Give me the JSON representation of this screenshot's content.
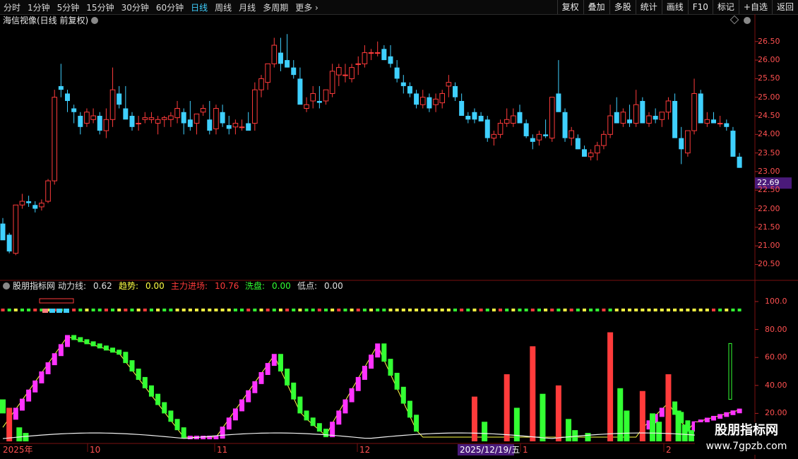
{
  "toolbar": {
    "timeframes": [
      "分时",
      "1分钟",
      "5分钟",
      "15分钟",
      "30分钟",
      "60分钟",
      "日线",
      "周线",
      "月线",
      "多周期",
      "更多"
    ],
    "active_index": 6,
    "right_buttons": [
      "复权",
      "叠加",
      "多股",
      "统计",
      "画线",
      "F10",
      "标记",
      "+自选",
      "返回"
    ]
  },
  "main": {
    "title": "海信视像(日线 前复权)",
    "current_price": "22.69",
    "y_ticks": [
      "26.50",
      "26.00",
      "25.50",
      "25.00",
      "24.50",
      "24.00",
      "23.50",
      "23.00",
      "22.50",
      "22.00",
      "21.50",
      "21.00",
      "20.50"
    ]
  },
  "indicator": {
    "name": "股朋指标网",
    "items": [
      {
        "label": "动力线:",
        "value": "0.62",
        "color": "#e0e0e0"
      },
      {
        "label": "趋势:",
        "value": "0.00",
        "color": "#ffff44"
      },
      {
        "label": "主力进场:",
        "value": "10.76",
        "color": "#ff3b3b"
      },
      {
        "label": "洗盘:",
        "value": "0.00",
        "color": "#33ff33"
      },
      {
        "label": "低点:",
        "value": "0.00",
        "color": "#e0e0e0"
      }
    ],
    "y_ticks": [
      "100.0",
      "80.00",
      "60.00",
      "40.00",
      "20.00"
    ]
  },
  "date_axis": {
    "year": "2025年",
    "months": [
      "10",
      "11",
      "12",
      "1",
      "2"
    ],
    "cursor_date": "2025/12/19/五"
  },
  "watermark": {
    "site": "股朋指标网",
    "url": "www.7gpzb.com"
  },
  "colors": {
    "up": "#ff3b3b",
    "down": "#3fd0ff",
    "magenta": "#ff33ff",
    "green": "#33ff33",
    "yellow": "#ffff44"
  },
  "chart_data": {
    "type": "candlestick",
    "ylim": [
      20.3,
      26.8
    ],
    "ohlc": [
      [
        21.6,
        21.75,
        21.2,
        21.15
      ],
      [
        21.3,
        21.35,
        20.8,
        20.85
      ],
      [
        20.8,
        22.1,
        20.75,
        22.1
      ],
      [
        22.1,
        22.4,
        22.0,
        22.2
      ],
      [
        22.2,
        22.35,
        22.05,
        22.15
      ],
      [
        22.1,
        22.2,
        21.9,
        22.0
      ],
      [
        22.05,
        22.25,
        21.95,
        22.15
      ],
      [
        22.2,
        22.8,
        22.15,
        22.75
      ],
      [
        22.75,
        25.2,
        22.65,
        25.0
      ],
      [
        25.3,
        25.9,
        25.0,
        25.2
      ],
      [
        25.1,
        25.2,
        24.6,
        24.9
      ],
      [
        24.7,
        24.8,
        24.3,
        24.6
      ],
      [
        24.5,
        24.6,
        24.0,
        24.2
      ],
      [
        24.3,
        24.7,
        24.2,
        24.6
      ],
      [
        24.4,
        24.7,
        24.3,
        24.5
      ],
      [
        24.5,
        24.6,
        24.0,
        24.1
      ],
      [
        24.1,
        24.7,
        23.9,
        24.4
      ],
      [
        24.4,
        25.8,
        24.2,
        25.2
      ],
      [
        25.1,
        25.3,
        24.7,
        24.8
      ],
      [
        24.7,
        25.3,
        24.5,
        24.4
      ],
      [
        24.5,
        24.6,
        24.1,
        24.2
      ],
      [
        24.3,
        24.5,
        24.1,
        24.3
      ],
      [
        24.4,
        24.6,
        24.3,
        24.45
      ],
      [
        24.4,
        24.6,
        24.3,
        24.45
      ],
      [
        24.3,
        24.5,
        24.0,
        24.4
      ],
      [
        24.4,
        24.5,
        24.2,
        24.45
      ],
      [
        24.4,
        24.6,
        24.2,
        24.5
      ],
      [
        24.45,
        24.9,
        24.3,
        24.7
      ],
      [
        24.6,
        24.7,
        24.0,
        24.3
      ],
      [
        24.4,
        24.9,
        24.1,
        24.2
      ],
      [
        24.3,
        24.5,
        24.0,
        24.55
      ],
      [
        24.6,
        24.8,
        24.5,
        24.7
      ],
      [
        24.4,
        24.9,
        24.0,
        24.1
      ],
      [
        24.15,
        24.8,
        24.0,
        24.7
      ],
      [
        24.6,
        24.8,
        24.2,
        24.3
      ],
      [
        24.25,
        24.5,
        24.0,
        24.15
      ],
      [
        24.2,
        24.4,
        24.0,
        24.3
      ],
      [
        24.2,
        24.4,
        24.1,
        24.2
      ],
      [
        24.3,
        24.6,
        24.2,
        24.1
      ],
      [
        24.3,
        25.4,
        24.1,
        25.2
      ],
      [
        25.2,
        25.6,
        25.0,
        25.5
      ],
      [
        25.4,
        25.8,
        25.2,
        25.9
      ],
      [
        25.9,
        26.6,
        25.8,
        26.4
      ],
      [
        26.2,
        26.6,
        25.7,
        25.9
      ],
      [
        26.0,
        26.7,
        25.8,
        25.8
      ],
      [
        25.8,
        26.0,
        25.5,
        25.6
      ],
      [
        25.5,
        25.8,
        24.9,
        24.8
      ],
      [
        24.7,
        25.0,
        24.6,
        24.8
      ],
      [
        24.9,
        25.3,
        24.7,
        25.1
      ],
      [
        24.9,
        25.3,
        24.7,
        24.85
      ],
      [
        24.9,
        25.2,
        24.8,
        25.2
      ],
      [
        25.1,
        25.9,
        25.0,
        25.7
      ],
      [
        25.6,
        25.9,
        25.3,
        25.8
      ],
      [
        25.6,
        25.9,
        25.4,
        25.6
      ],
      [
        25.5,
        25.9,
        25.4,
        25.8
      ],
      [
        25.9,
        26.1,
        25.6,
        25.9
      ],
      [
        25.9,
        26.4,
        25.8,
        26.2
      ],
      [
        26.2,
        26.3,
        26.0,
        26.2
      ],
      [
        26.2,
        26.5,
        26.1,
        26.2
      ],
      [
        26.3,
        26.4,
        26.0,
        26.0
      ],
      [
        26.1,
        26.4,
        25.8,
        25.9
      ],
      [
        25.8,
        26.0,
        25.4,
        25.5
      ],
      [
        25.4,
        25.6,
        25.1,
        25.3
      ],
      [
        25.3,
        25.4,
        25.0,
        25.1
      ],
      [
        25.1,
        25.2,
        24.7,
        24.8
      ],
      [
        24.8,
        25.2,
        24.7,
        25.0
      ],
      [
        25.0,
        25.1,
        24.6,
        24.7
      ],
      [
        24.8,
        25.1,
        24.6,
        24.95
      ],
      [
        24.85,
        25.2,
        24.7,
        25.1
      ],
      [
        25.3,
        25.6,
        25.0,
        25.4
      ],
      [
        25.3,
        25.4,
        24.9,
        25.0
      ],
      [
        24.9,
        25.1,
        24.5,
        24.5
      ],
      [
        24.5,
        24.6,
        24.3,
        24.4
      ],
      [
        24.6,
        24.7,
        24.3,
        24.4
      ],
      [
        24.5,
        24.6,
        24.4,
        24.35
      ],
      [
        24.4,
        24.5,
        23.8,
        23.9
      ],
      [
        23.9,
        24.1,
        23.7,
        24.0
      ],
      [
        24.0,
        24.4,
        23.9,
        24.3
      ],
      [
        24.3,
        24.7,
        24.2,
        24.4
      ],
      [
        24.3,
        24.7,
        24.2,
        24.5
      ],
      [
        24.6,
        24.8,
        24.3,
        24.3
      ],
      [
        24.3,
        24.4,
        23.9,
        23.95
      ],
      [
        23.9,
        24.0,
        23.6,
        23.8
      ],
      [
        23.85,
        24.1,
        23.7,
        24.0
      ],
      [
        24.0,
        24.4,
        23.9,
        23.95
      ],
      [
        23.9,
        25.0,
        23.8,
        25.0
      ],
      [
        25.1,
        26.0,
        24.9,
        24.6
      ],
      [
        24.6,
        24.7,
        23.8,
        23.9
      ],
      [
        23.9,
        24.2,
        23.7,
        24.1
      ],
      [
        23.9,
        24.0,
        23.6,
        23.6
      ],
      [
        23.6,
        23.7,
        23.4,
        23.4
      ],
      [
        23.4,
        23.6,
        23.3,
        23.5
      ],
      [
        23.5,
        23.8,
        23.3,
        23.7
      ],
      [
        23.7,
        24.1,
        23.6,
        24.0
      ],
      [
        24.0,
        24.8,
        23.9,
        24.5
      ],
      [
        24.6,
        25.0,
        24.3,
        24.3
      ],
      [
        24.3,
        24.7,
        24.2,
        24.6
      ],
      [
        24.4,
        24.8,
        24.2,
        24.3
      ],
      [
        24.3,
        25.2,
        24.2,
        24.8
      ],
      [
        24.9,
        25.0,
        24.3,
        24.3
      ],
      [
        24.3,
        24.6,
        24.2,
        24.5
      ],
      [
        24.5,
        24.7,
        24.3,
        24.4
      ],
      [
        24.4,
        24.6,
        24.2,
        24.6
      ],
      [
        24.6,
        25.0,
        24.4,
        24.9
      ],
      [
        24.9,
        25.1,
        24.0,
        23.9
      ],
      [
        23.9,
        24.2,
        23.2,
        23.6
      ],
      [
        23.5,
        24.1,
        23.4,
        24.1
      ],
      [
        24.1,
        25.5,
        24.0,
        25.1
      ],
      [
        25.1,
        25.2,
        24.3,
        24.3
      ],
      [
        24.3,
        24.6,
        24.2,
        24.4
      ],
      [
        24.4,
        24.6,
        24.3,
        24.3
      ],
      [
        24.3,
        24.5,
        24.2,
        24.3
      ],
      [
        24.3,
        24.4,
        24.1,
        24.2
      ],
      [
        24.1,
        24.2,
        23.4,
        23.4
      ],
      [
        23.4,
        23.5,
        23.1,
        23.1
      ]
    ]
  }
}
